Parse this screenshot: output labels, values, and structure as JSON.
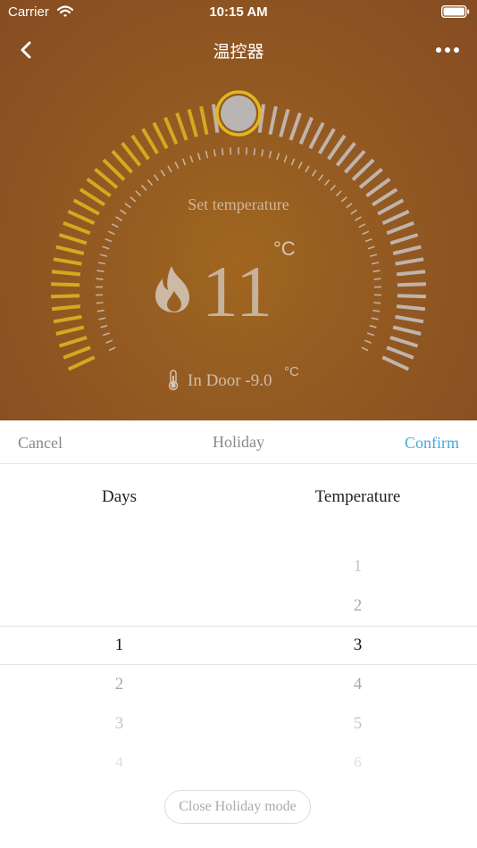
{
  "status_bar": {
    "carrier": "Carrier",
    "time": "10:15 AM"
  },
  "nav": {
    "title": "温控器",
    "back_icon": "chevron-left-icon",
    "more_icon": "more-dots-icon"
  },
  "thermostat": {
    "set_label": "Set temperature",
    "set_temperature": "11",
    "unit": "°C",
    "indoor_label": "In Door -9.0",
    "indoor_unit": "°C",
    "heat_icon": "flame-icon",
    "colors": {
      "active_tick": "#d6a821",
      "inactive_tick": "#c1b3aa",
      "knob": "#b9b5b3",
      "knob_ring": "#e0b820"
    }
  },
  "picker": {
    "cancel": "Cancel",
    "title": "Holiday",
    "confirm": "Confirm",
    "confirm_color": "#45a7e2",
    "days_header": "Days",
    "temperature_header": "Temperature",
    "days_options": [
      "1",
      "2",
      "3",
      "4"
    ],
    "days_selected": "1",
    "temperature_options": [
      "1",
      "2",
      "3",
      "4",
      "5",
      "6"
    ],
    "temperature_selected": "3"
  },
  "close_holiday": "Close Holiday mode"
}
